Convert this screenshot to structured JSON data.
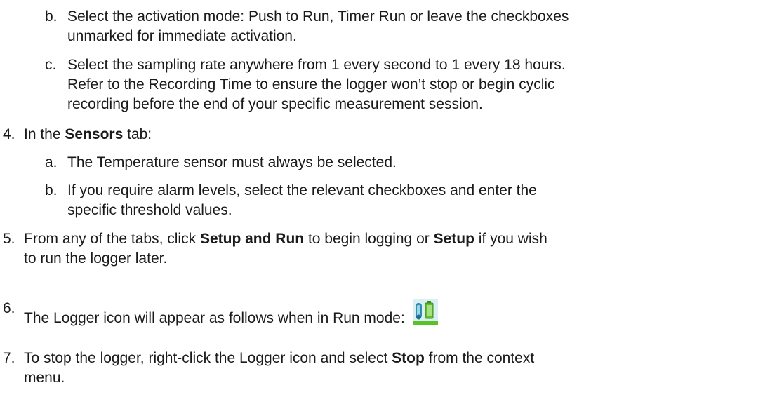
{
  "steps": {
    "b1": {
      "marker": "b.",
      "lines": [
        "Select the activation mode: Push to Run, Timer Run or leave the checkboxes",
        "unmarked for immediate activation."
      ]
    },
    "c1": {
      "marker": "c.",
      "lines": [
        "Select the sampling rate anywhere from 1 every second to 1 every 18 hours.",
        "Refer to the Recording Time to ensure the logger won’t stop or begin cyclic",
        "recording before the end of your specific measurement session."
      ]
    },
    "s4": {
      "marker": "4.",
      "pre": "In the ",
      "bold": "Sensors",
      "post": " tab:"
    },
    "a2": {
      "marker": "a.",
      "lines": [
        "The Temperature sensor must always be selected."
      ]
    },
    "b2": {
      "marker": "b.",
      "lines": [
        "If you require alarm levels, select the relevant checkboxes and enter the",
        "specific threshold values."
      ]
    },
    "s5": {
      "marker": "5.",
      "l1_pre": "From any of the tabs, click ",
      "l1_b1": "Setup and Run",
      "l1_mid": " to begin logging or ",
      "l1_b2": "Setup",
      "l1_post": " if you wish",
      "l2": "to run the logger later."
    },
    "s6": {
      "marker": "6.",
      "text": "The Logger icon will appear as follows when in Run mode:",
      "icon": "logger-run-icon"
    },
    "s7": {
      "marker": "7.",
      "l1_pre": "To stop the logger, right-click the Logger icon and select ",
      "l1_bold": "Stop",
      "l1_post": " from the context",
      "l2": "menu."
    }
  },
  "colors": {
    "text": "#1a1a1a",
    "icon_green": "#5cc02a",
    "icon_blue": "#2f8fb0"
  }
}
